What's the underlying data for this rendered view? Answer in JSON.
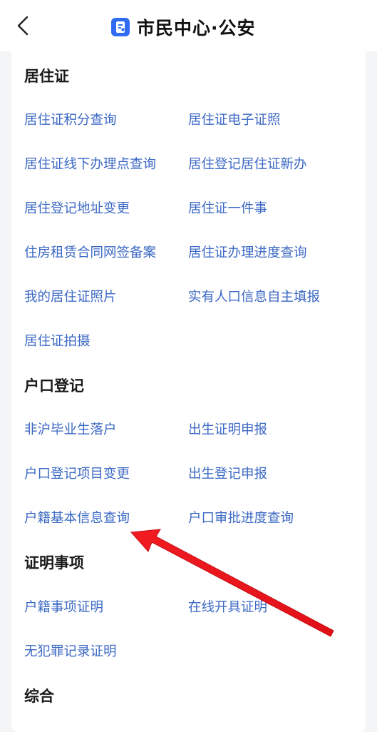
{
  "header": {
    "title": "市民中心·公安",
    "back_icon": "chevron-left-icon",
    "app_icon": "document-icon",
    "app_icon_color": "#2f6cf3"
  },
  "sections": [
    {
      "title": "居住证",
      "items": [
        "居住证积分查询",
        "居住证电子证照",
        "居住证线下办理点查询",
        "居住登记居住证新办",
        "居住登记地址变更",
        "居住证一件事",
        "住房租赁合同网签备案",
        "居住证办理进度查询",
        "我的居住证照片",
        "实有人口信息自主填报",
        "居住证拍摄"
      ]
    },
    {
      "title": "户口登记",
      "items": [
        "非沪毕业生落户",
        "出生证明申报",
        "户口登记项目变更",
        "出生登记申报",
        "户籍基本信息查询",
        "户口审批进度查询"
      ]
    },
    {
      "title": "证明事项",
      "items": [
        "户籍事项证明",
        "在线开具证明",
        "无犯罪记录证明"
      ]
    },
    {
      "title": "综合",
      "items": []
    }
  ],
  "colors": {
    "link": "#3c69c4",
    "annotation_arrow": "#e8141c"
  }
}
